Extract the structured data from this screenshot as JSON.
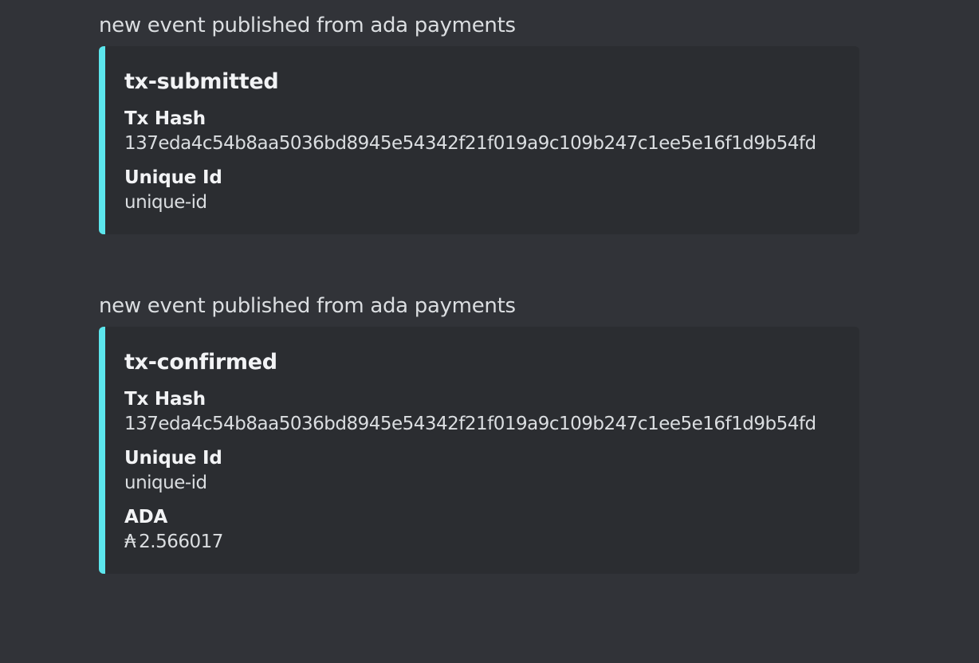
{
  "messages": [
    {
      "text": "new event published from ada payments",
      "embed": {
        "title": "tx-submitted",
        "accent_color": "#5ce6ed",
        "fields": [
          {
            "name": "Tx Hash",
            "value": "137eda4c54b8aa5036bd8945e54342f21f019a9c109b247c1ee5e16f1d9b54fd"
          },
          {
            "name": "Unique Id",
            "value": "unique-id"
          }
        ]
      }
    },
    {
      "text": "new event published from ada payments",
      "embed": {
        "title": "tx-confirmed",
        "accent_color": "#5ce6ed",
        "fields": [
          {
            "name": "Tx Hash",
            "value": "137eda4c54b8aa5036bd8945e54342f21f019a9c109b247c1ee5e16f1d9b54fd"
          },
          {
            "name": "Unique Id",
            "value": "unique-id"
          },
          {
            "name": "ADA",
            "value": "2.566017",
            "symbol": "₳"
          }
        ]
      }
    }
  ]
}
